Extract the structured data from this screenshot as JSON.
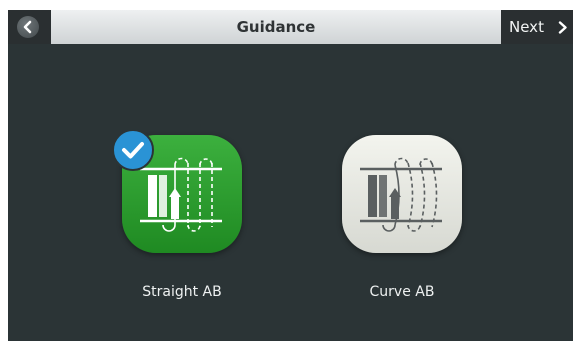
{
  "header": {
    "title": "Guidance",
    "next_label": "Next",
    "back_icon": "chevron-left-icon",
    "next_icon": "chevron-right-icon"
  },
  "options": [
    {
      "label": "Straight AB",
      "selected": true,
      "icon": "straight-ab-icon"
    },
    {
      "label": "Curve AB",
      "selected": false,
      "icon": "curve-ab-icon"
    }
  ],
  "colors": {
    "selected_tile": "#2ea232",
    "unselected_tile": "#e4e6df",
    "check_badge": "#2a93d5",
    "background": "#2b3436"
  }
}
